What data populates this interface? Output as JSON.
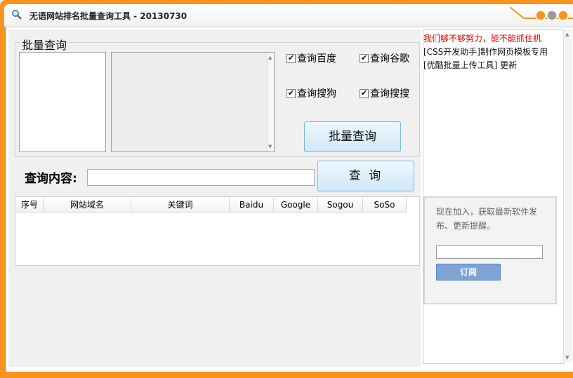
{
  "window": {
    "title": "无语网站排名批量查询工具 - 20130730"
  },
  "batch_group": {
    "title": "批量查询",
    "checkboxes": [
      {
        "label": "查询百度",
        "checked": true
      },
      {
        "label": "查询谷歌",
        "checked": true
      },
      {
        "label": "查询搜狗",
        "checked": true
      },
      {
        "label": "查询搜搜",
        "checked": true
      }
    ],
    "batch_button": "批量查询"
  },
  "query": {
    "label": "查询内容:",
    "value": "",
    "button": "查 询"
  },
  "results_table": {
    "columns": [
      "序号",
      "网站域名",
      "关键词",
      "Baidu",
      "Google",
      "Sogou",
      "SoSo"
    ],
    "rows": []
  },
  "sidebar": {
    "headline": "我们够不够努力，能不能抓住机",
    "links": [
      "[CSS开发助手]制作网页模板专用",
      "[优酷批量上传工具] 更新"
    ],
    "subscribe": {
      "text": "现在加入，获取最新软件发布、更新提醒。",
      "input_value": "",
      "button": "订阅"
    }
  },
  "icons": {
    "title": "magnifier-icon"
  },
  "colors": {
    "frame": "#f7941d",
    "headline": "#e00000",
    "subscribe_button": "#7ea3d4"
  }
}
